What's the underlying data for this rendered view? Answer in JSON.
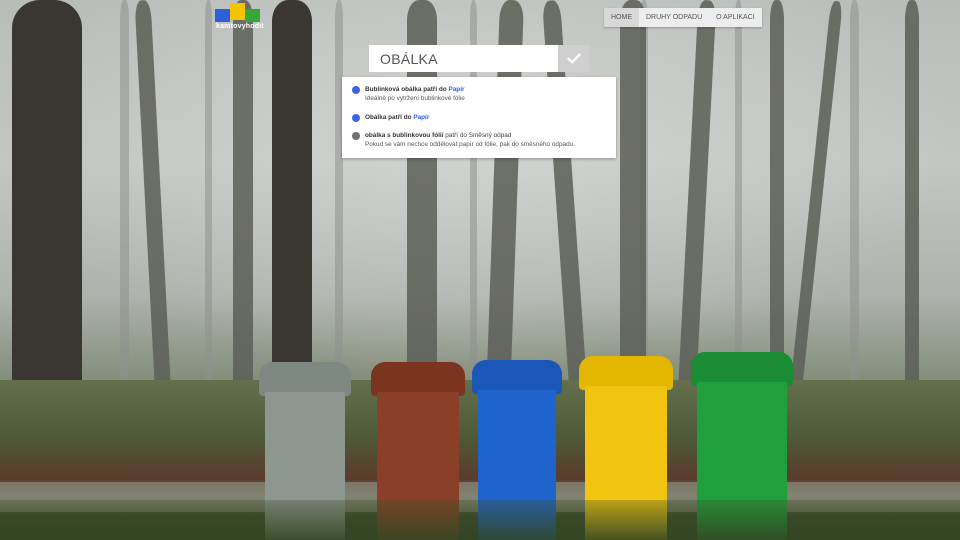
{
  "logo": {
    "text": "kamtovyhodit"
  },
  "nav": {
    "items": [
      {
        "label": "HOME",
        "active": true
      },
      {
        "label": "DRUHY ODPADU",
        "active": false
      },
      {
        "label": "O APLIKACI",
        "active": false
      }
    ]
  },
  "search": {
    "value": "OBÁLKA",
    "submit_icon": "check-icon"
  },
  "results": [
    {
      "name": "Bublinková obálka",
      "connector": "patří do",
      "category": "Papír",
      "note": "Ideálně po vytržení bublinkové fólie",
      "dot_color": "#3a63e8",
      "category_color": "#2e5ee0"
    },
    {
      "name": "Obálka",
      "connector": "patří do",
      "category": "Papír",
      "note": "",
      "dot_color": "#3a63e8",
      "category_color": "#2e5ee0"
    },
    {
      "name": "obálka s bublinkovou fólií",
      "connector": "patří do",
      "category": "Směsný odpad",
      "note": "Pokud se vám nechce oddělovat papír od fólie, pak do směsného odpadu.",
      "dot_color": "#707070",
      "category_color": "#444444"
    }
  ],
  "bins": [
    {
      "color": "#8e9690",
      "lid": "#7e8882"
    },
    {
      "color": "#8a4028",
      "lid": "#7a3420"
    },
    {
      "color": "#1f63cc",
      "lid": "#1a57b8"
    },
    {
      "color": "#f1c40f",
      "lid": "#e3b600"
    },
    {
      "color": "#20a03c",
      "lid": "#1a8c33"
    }
  ]
}
